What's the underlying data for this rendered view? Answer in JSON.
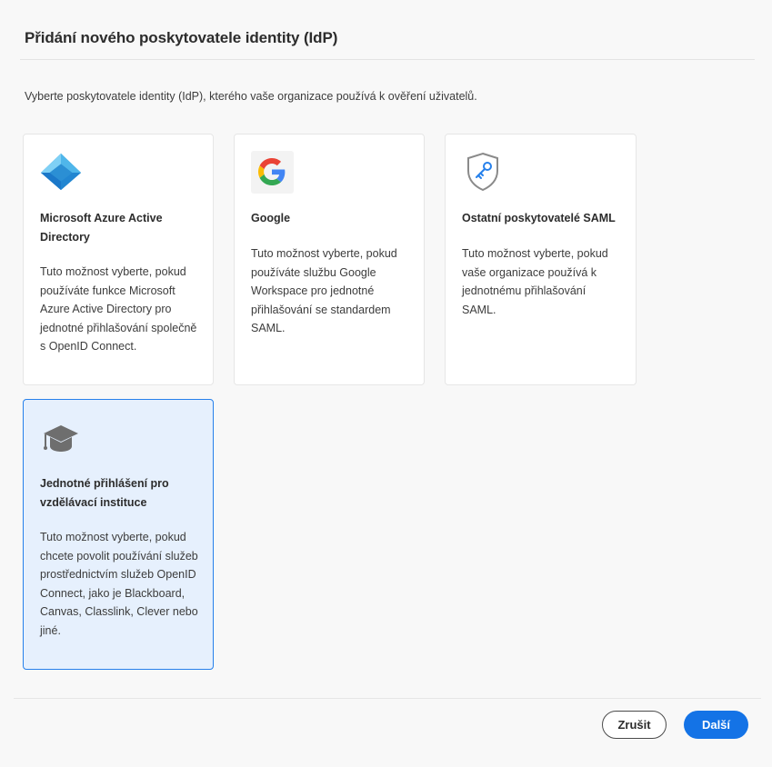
{
  "dialog": {
    "title": "Přidání nového poskytovatele identity (IdP)",
    "intro": "Vyberte poskytovatele identity (IdP), kterého vaše organizace používá k ověření uživatelů."
  },
  "providers": [
    {
      "icon": "azure-icon",
      "name": "Microsoft Azure Active Directory",
      "description": "Tuto možnost vyberte, pokud používáte funkce Microsoft Azure Active Directory pro jednotné přihlašování společně s OpenID Connect.",
      "selected": false
    },
    {
      "icon": "google-icon",
      "name": "Google",
      "description": "Tuto možnost vyberte, pokud používáte službu Google Workspace pro jednotné přihlašování se standardem SAML.",
      "selected": false
    },
    {
      "icon": "shield-key-icon",
      "name": "Ostatní poskytovatelé SAML",
      "description": "Tuto možnost vyberte, pokud vaše organizace používá k jednotnému přihlašování SAML.",
      "selected": false
    },
    {
      "icon": "graduation-cap-icon",
      "name": "Jednotné přihlášení pro vzdělávací instituce",
      "description": "Tuto možnost vyberte, pokud chcete povolit používání služeb prostřednictvím služeb OpenID Connect, jako je Blackboard, Canvas, Classlink, Clever nebo jiné.",
      "selected": true
    }
  ],
  "footer": {
    "cancel_label": "Zrušit",
    "next_label": "Další"
  },
  "colors": {
    "accent": "#1473e6",
    "selected_border": "#2680eb",
    "selected_bg": "#e6f0fd"
  }
}
